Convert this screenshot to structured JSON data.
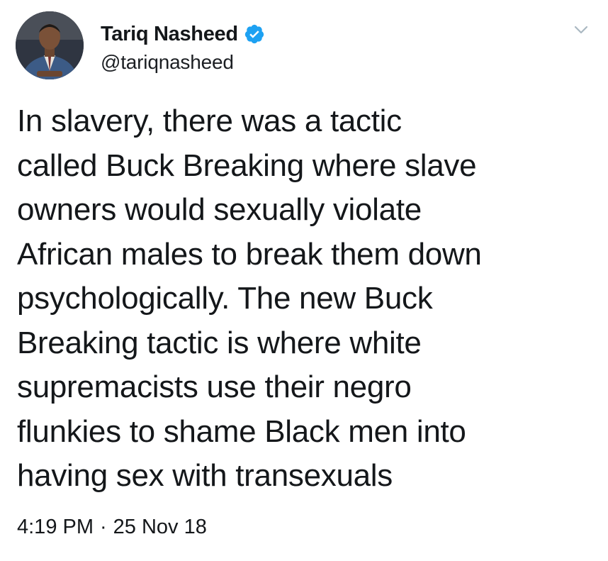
{
  "author": {
    "display_name": "Tariq Nasheed",
    "handle": "@tariqnasheed",
    "verified": true
  },
  "icons": {
    "verified": "verified-badge-icon",
    "menu": "chevron-down-icon"
  },
  "tweet": {
    "text": "In slavery, there was a tactic\ncalled Buck Breaking where slave\nowners would sexually violate\nAfrican males to break them down\npsychologically. The new Buck\nBreaking tactic is where white\nsupremacists use their negro\nflunkies to shame Black men into\nhaving sex with transexuals"
  },
  "meta": {
    "time": "4:19 PM",
    "separator": "·",
    "date": "25 Nov 18"
  },
  "colors": {
    "verified_blue": "#1da1f2",
    "text": "#14171a",
    "caret": "#aab8c2"
  }
}
